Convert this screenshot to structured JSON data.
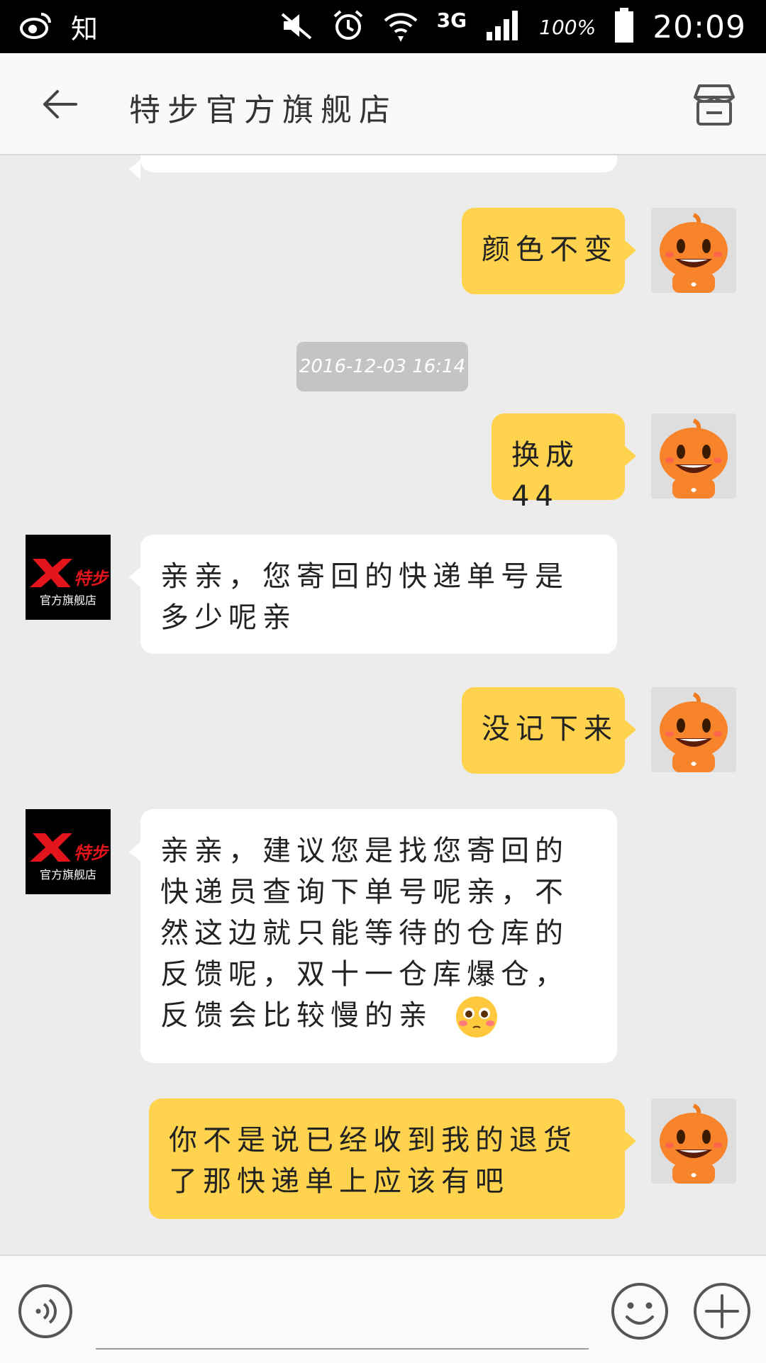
{
  "status_bar": {
    "left_text": "知",
    "network": "3G",
    "battery": "100%",
    "time": "20:09"
  },
  "header": {
    "title": "特步官方旗舰店"
  },
  "chat": {
    "timestamp": "2016-12-03 16:14",
    "shop_avatar_brand": "特步",
    "shop_avatar_caption": "官方旗舰店",
    "messages": [
      {
        "from": "me",
        "text": "颜色不变"
      },
      {
        "from": "me",
        "text": "换成44"
      },
      {
        "from": "shop",
        "text": "亲亲，您寄回的快递单号是多少呢亲"
      },
      {
        "from": "me",
        "text": "没记下来"
      },
      {
        "from": "shop",
        "text": "亲亲，建议您是找您寄回的快递员查询下单号呢亲，不然这边就只能等待的仓库的反馈呢，双十一仓库爆仓，反馈会比较慢的亲"
      },
      {
        "from": "me",
        "text": "你不是说已经收到我的退货了那快递单上应该有吧"
      }
    ]
  },
  "icons": {
    "back": "arrow-left-icon",
    "shop": "store-icon",
    "voice": "voice-icon",
    "emoji": "smiley-icon",
    "plus": "plus-icon"
  },
  "colors": {
    "outgoing_bubble": "#ffd34e",
    "incoming_bubble": "#ffffff",
    "background": "#ececec"
  }
}
